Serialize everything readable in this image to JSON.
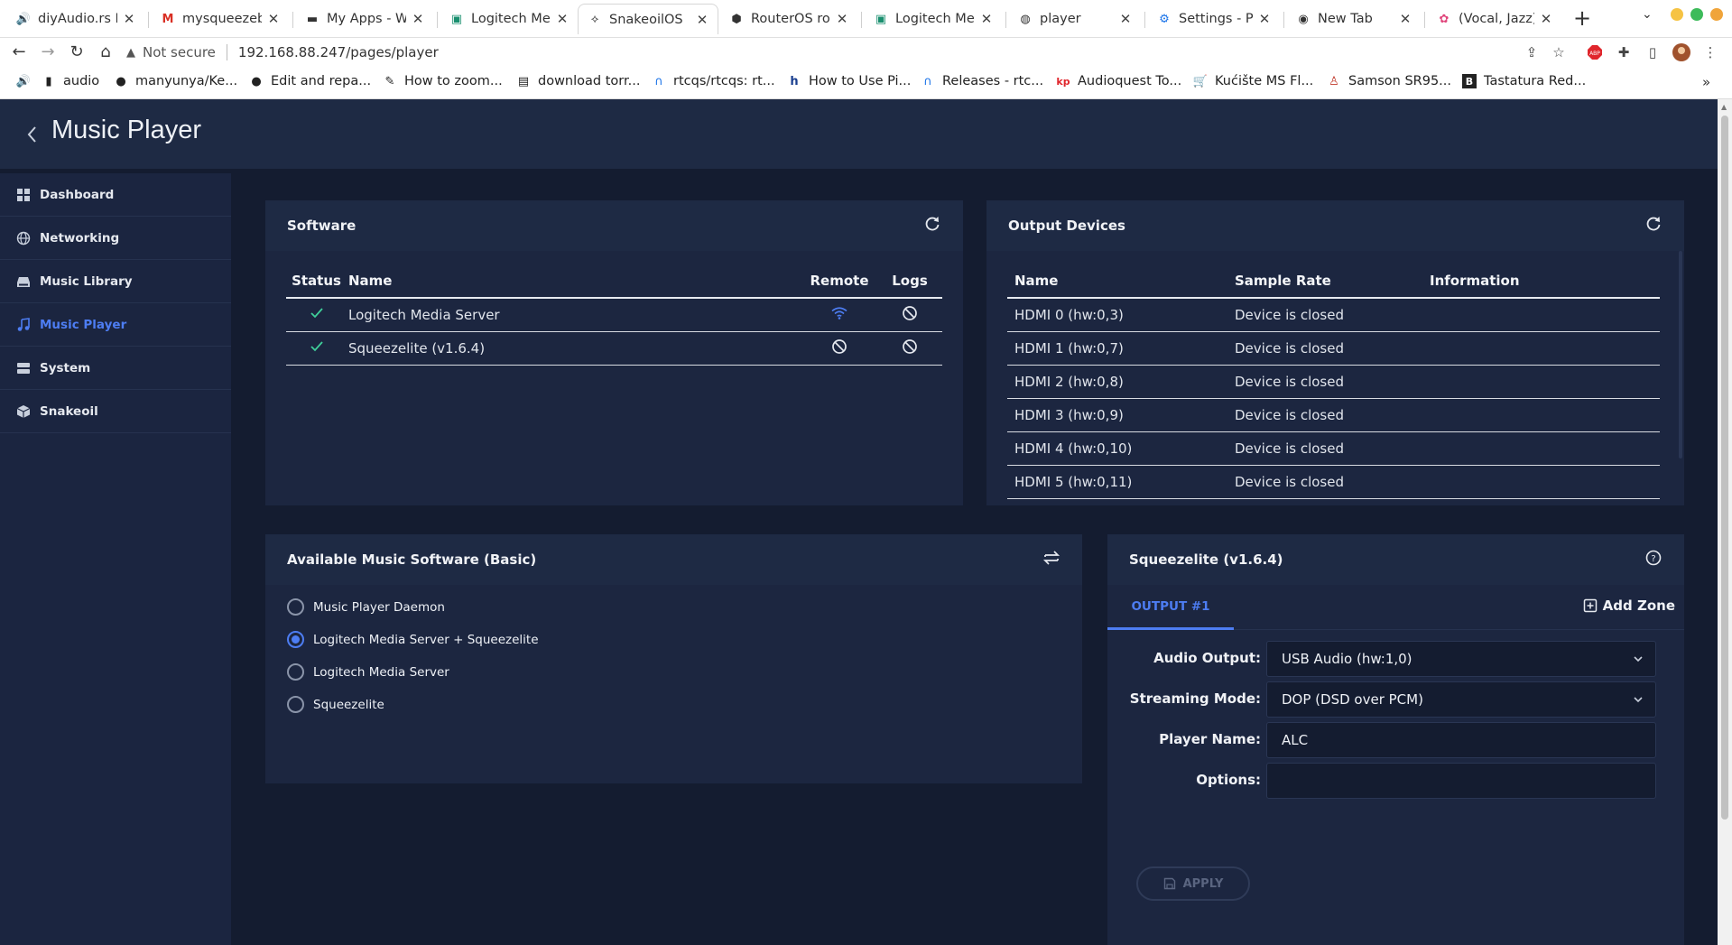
{
  "browser": {
    "tabs": [
      {
        "title": "diyAudio.rs L",
        "icon": "speaker-icon"
      },
      {
        "title": "mysqueezeb",
        "icon": "gmail-icon"
      },
      {
        "title": "My Apps - We",
        "icon": "apps-icon"
      },
      {
        "title": "Logitech Mec",
        "icon": "logitech-icon"
      },
      {
        "title": "SnakeoilOS",
        "icon": "snakeoil-icon",
        "active": true
      },
      {
        "title": "RouterOS rou",
        "icon": "routeros-icon"
      },
      {
        "title": "Logitech Mec",
        "icon": "logitech-icon"
      },
      {
        "title": "player",
        "icon": "globe-icon"
      },
      {
        "title": "Settings - Pa",
        "icon": "settings-icon"
      },
      {
        "title": "New Tab",
        "icon": "chrome-icon"
      },
      {
        "title": "(Vocal, Jazz) I",
        "icon": "music-icon"
      }
    ],
    "new_tab": "+",
    "address": {
      "security": "Not secure",
      "url": "192.168.88.247/pages/player"
    },
    "bookmarks": [
      {
        "label": "",
        "icon": "speaker-icon"
      },
      {
        "label": "audio",
        "icon": "folder-icon"
      },
      {
        "label": "manyunya/Ke...",
        "icon": "github-icon"
      },
      {
        "label": "Edit and repa...",
        "icon": "github-icon"
      },
      {
        "label": "How to zoom...",
        "icon": "pen-icon"
      },
      {
        "label": "download torr...",
        "icon": "page-icon"
      },
      {
        "label": "rtcqs/rtcqs: rt...",
        "icon": "arch-icon"
      },
      {
        "label": "How to Use Pi...",
        "icon": "h-icon"
      },
      {
        "label": "Releases - rtc...",
        "icon": "arch-icon"
      },
      {
        "label": "Audioquest To...",
        "icon": "kp-icon"
      },
      {
        "label": "Kućište MS Fl...",
        "icon": "cart-icon"
      },
      {
        "label": "Samson SR95...",
        "icon": "person-icon"
      },
      {
        "label": "Tastatura Red...",
        "icon": "b-icon"
      }
    ],
    "more": "»"
  },
  "app": {
    "title": "Music Player",
    "sidebar": [
      {
        "label": "Dashboard",
        "icon": "dashboard-icon"
      },
      {
        "label": "Networking",
        "icon": "globe-icon"
      },
      {
        "label": "Music Library",
        "icon": "drive-icon"
      },
      {
        "label": "Music Player",
        "icon": "music-note-icon",
        "active": true
      },
      {
        "label": "System",
        "icon": "server-icon"
      },
      {
        "label": "Snakeoil",
        "icon": "cube-icon"
      }
    ],
    "software": {
      "title": "Software",
      "headers": [
        "Status",
        "Name",
        "Remote",
        "Logs"
      ],
      "rows": [
        {
          "status": "ok",
          "name": "Logitech Media Server",
          "remote": "wifi",
          "logs": "blocked"
        },
        {
          "status": "ok",
          "name": "Squeezelite (v1.6.4)",
          "remote": "blocked",
          "logs": "blocked"
        }
      ]
    },
    "output_devices": {
      "title": "Output Devices",
      "headers": [
        "Name",
        "Sample Rate",
        "Information"
      ],
      "rows": [
        {
          "name": "HDMI 0  (hw:0,3)",
          "rate": "Device is closed",
          "info": ""
        },
        {
          "name": "HDMI 1  (hw:0,7)",
          "rate": "Device is closed",
          "info": ""
        },
        {
          "name": "HDMI 2  (hw:0,8)",
          "rate": "Device is closed",
          "info": ""
        },
        {
          "name": "HDMI 3  (hw:0,9)",
          "rate": "Device is closed",
          "info": ""
        },
        {
          "name": "HDMI 4  (hw:0,10)",
          "rate": "Device is closed",
          "info": ""
        },
        {
          "name": "HDMI 5  (hw:0,11)",
          "rate": "Device is closed",
          "info": ""
        }
      ]
    },
    "available": {
      "title": "Available Music Software  (Basic)",
      "options": [
        {
          "label": "Music Player Daemon",
          "selected": false
        },
        {
          "label": "Logitech Media Server + Squeezelite",
          "selected": true
        },
        {
          "label": "Logitech Media Server",
          "selected": false
        },
        {
          "label": "Squeezelite",
          "selected": false
        }
      ]
    },
    "squeezelite": {
      "title": "Squeezelite (v1.6.4)",
      "tab": "OUTPUT #1",
      "add_zone": "Add Zone",
      "fields": {
        "audio_output": {
          "label": "Audio Output:",
          "value": "USB Audio (hw:1,0)"
        },
        "streaming_mode": {
          "label": "Streaming Mode:",
          "value": "DOP (DSD over PCM)"
        },
        "player_name": {
          "label": "Player Name:",
          "value": "ALC"
        },
        "options": {
          "label": "Options:",
          "value": ""
        }
      },
      "apply": "APPLY"
    }
  },
  "colors": {
    "accent": "#4d7df2",
    "check": "#3fcf9a",
    "panel": "#1c2640",
    "background": "#141c30"
  }
}
